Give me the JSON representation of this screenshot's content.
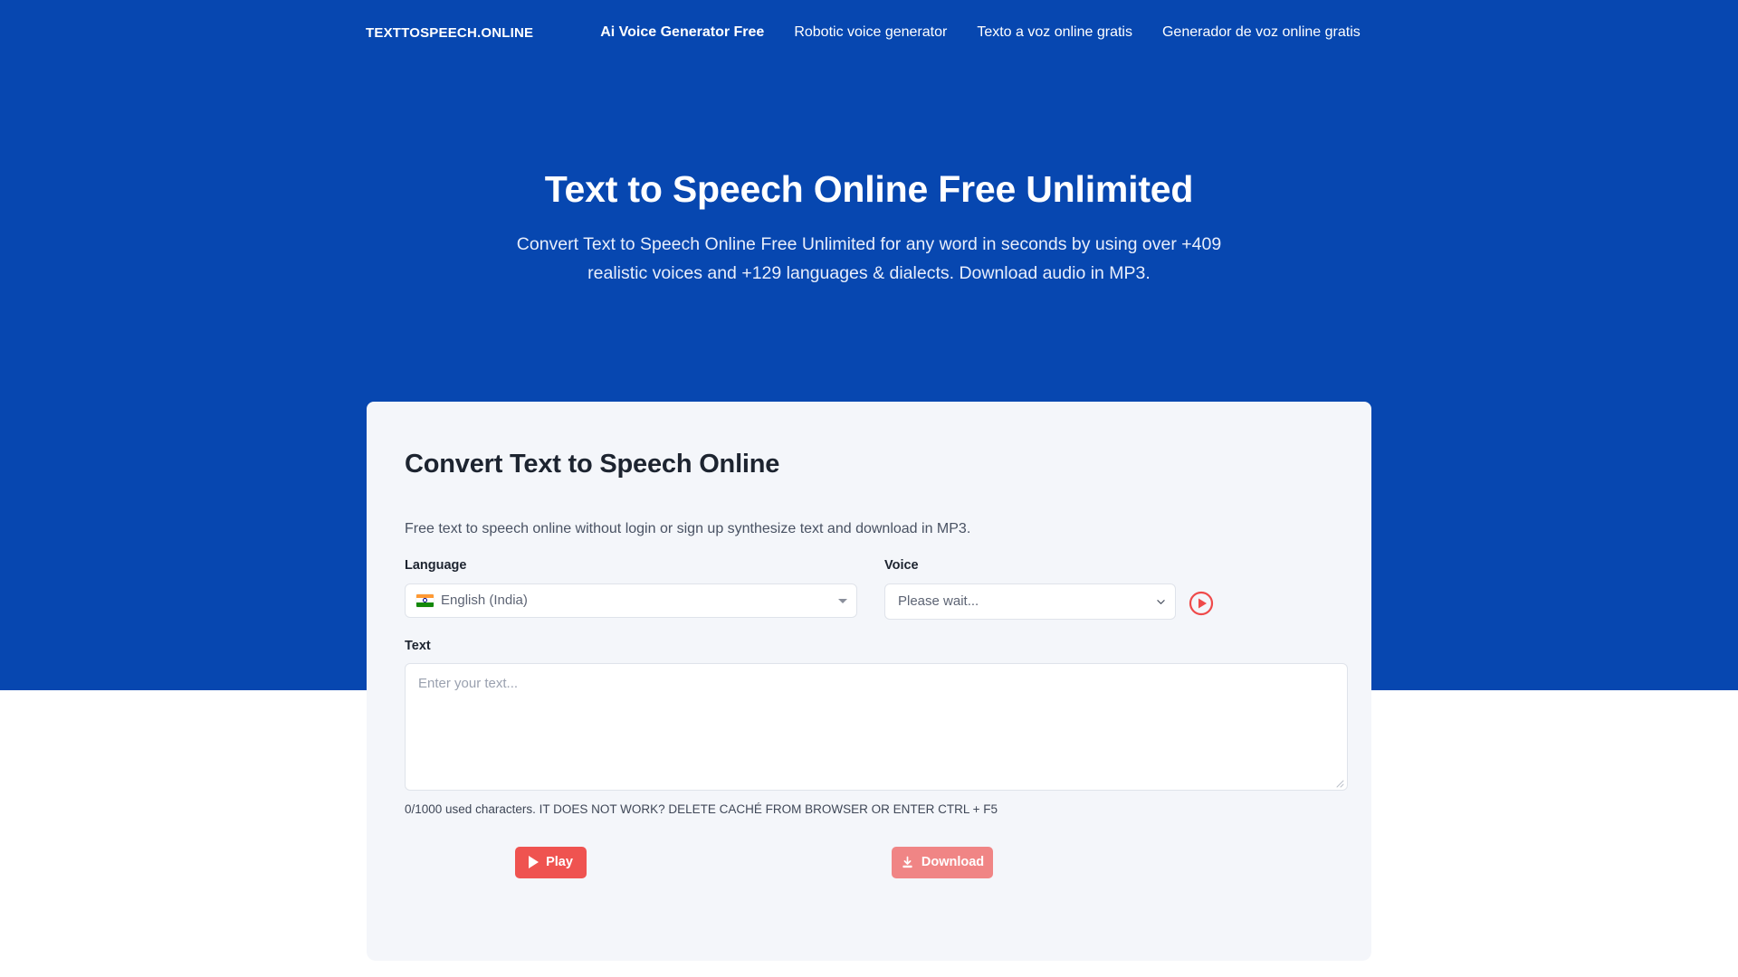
{
  "site": {
    "brand": "TEXTTOSPEECH.ONLINE",
    "nav_links": [
      {
        "label": "Ai Voice Generator Free",
        "active": true
      },
      {
        "label": "Robotic voice generator",
        "active": false
      },
      {
        "label": "Texto a voz online gratis",
        "active": false
      },
      {
        "label": "Generador de voz online gratis",
        "active": false
      }
    ]
  },
  "hero": {
    "title": "Text to Speech Online Free Unlimited",
    "subtitle": "Convert Text to Speech Online Free Unlimited for any word in seconds by using over +409 realistic voices and +129 languages & dialects. Download audio in MP3."
  },
  "card": {
    "title": "Convert Text to Speech Online",
    "description": "Free text to speech online without login or sign up synthesize text and download in MP3.",
    "language": {
      "label": "Language",
      "selected": "English (India)",
      "flag": "india-flag-icon"
    },
    "voice": {
      "label": "Voice",
      "selected": "Please wait...",
      "preview_icon": "play-circle-icon"
    },
    "text": {
      "label": "Text",
      "value": "",
      "placeholder": "Enter your text..."
    },
    "counter_note": "0/1000 used characters. IT DOES NOT WORK? DELETE CACHÉ FROM BROWSER OR ENTER CTRL + F5",
    "buttons": {
      "play": "Play",
      "download": "Download"
    }
  },
  "colors": {
    "hero_background": "#0747b0",
    "card_background": "#f4f6fa",
    "accent_red": "#ef5350",
    "accent_red_muted": "#f08585"
  }
}
